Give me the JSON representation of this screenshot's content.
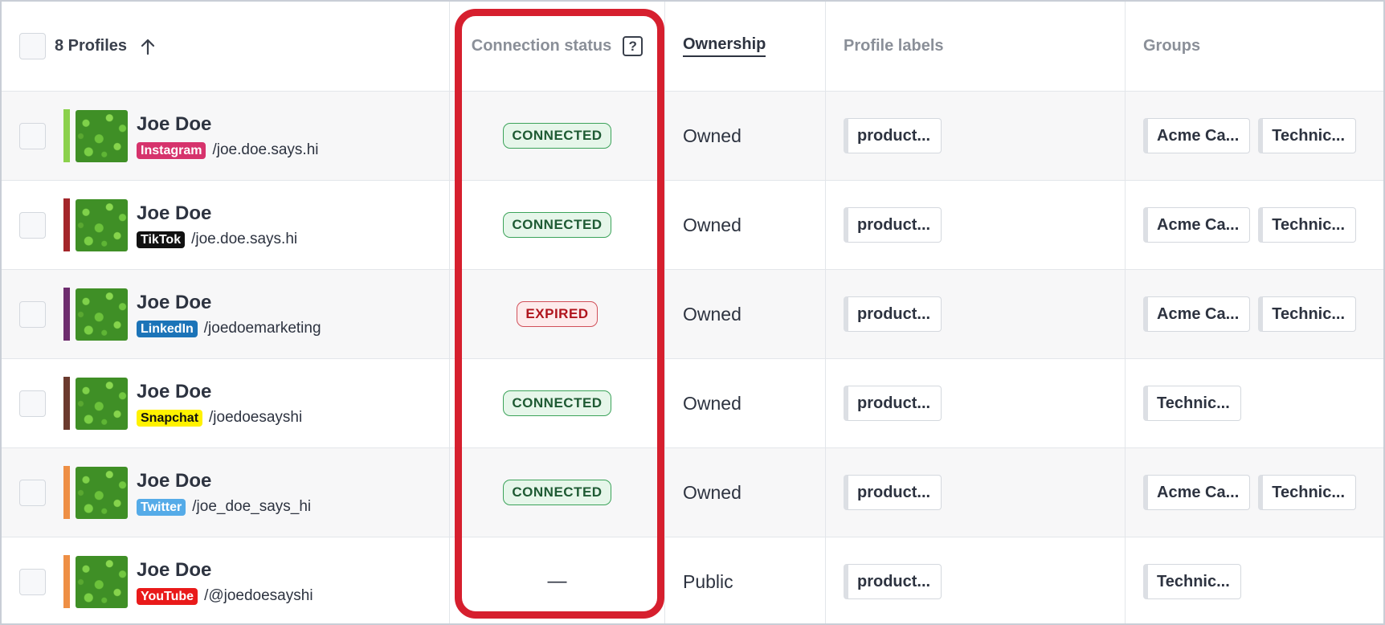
{
  "header": {
    "profiles_count": "8 Profiles",
    "connection_status": "Connection status",
    "help_glyph": "?",
    "ownership": "Ownership",
    "profile_labels": "Profile labels",
    "groups": "Groups"
  },
  "rows": [
    {
      "name": "Joe Doe",
      "network": "Instagram",
      "network_bg": "#d6336c",
      "network_fg": "#ffffff",
      "accent": "#8bd14c",
      "handle": "/joe.doe.says.hi",
      "status": "CONNECTED",
      "ownership": "Owned",
      "label": "product...",
      "groups": [
        "Acme Ca...",
        "Technic..."
      ]
    },
    {
      "name": "Joe Doe",
      "network": "TikTok",
      "network_bg": "#111111",
      "network_fg": "#ffffff",
      "accent": "#a3262a",
      "handle": "/joe.doe.says.hi",
      "status": "CONNECTED",
      "ownership": "Owned",
      "label": "product...",
      "groups": [
        "Acme Ca...",
        "Technic..."
      ]
    },
    {
      "name": "Joe Doe",
      "network": "LinkedIn",
      "network_bg": "#1c74b8",
      "network_fg": "#ffffff",
      "accent": "#6e2d6e",
      "handle": "/joedoemarketing",
      "status": "EXPIRED",
      "ownership": "Owned",
      "label": "product...",
      "groups": [
        "Acme Ca...",
        "Technic..."
      ]
    },
    {
      "name": "Joe Doe",
      "network": "Snapchat",
      "network_bg": "#fff200",
      "network_fg": "#111111",
      "accent": "#6b3a2e",
      "handle": "/joedoesayshi",
      "status": "CONNECTED",
      "ownership": "Owned",
      "label": "product...",
      "groups": [
        "Technic..."
      ]
    },
    {
      "name": "Joe Doe",
      "network": "Twitter",
      "network_bg": "#55abe8",
      "network_fg": "#ffffff",
      "accent": "#ee8f45",
      "handle": "/joe_doe_says_hi",
      "status": "CONNECTED",
      "ownership": "Owned",
      "label": "product...",
      "groups": [
        "Acme Ca...",
        "Technic..."
      ]
    },
    {
      "name": "Joe Doe",
      "network": "YouTube",
      "network_bg": "#e91a1a",
      "network_fg": "#ffffff",
      "accent": "#ee8f45",
      "handle": "/@joedoesayshi",
      "status": "—",
      "ownership": "Public",
      "label": "product...",
      "groups": [
        "Technic..."
      ]
    }
  ],
  "icons": {
    "sort": "arrow-up-icon",
    "help": "question-icon"
  }
}
